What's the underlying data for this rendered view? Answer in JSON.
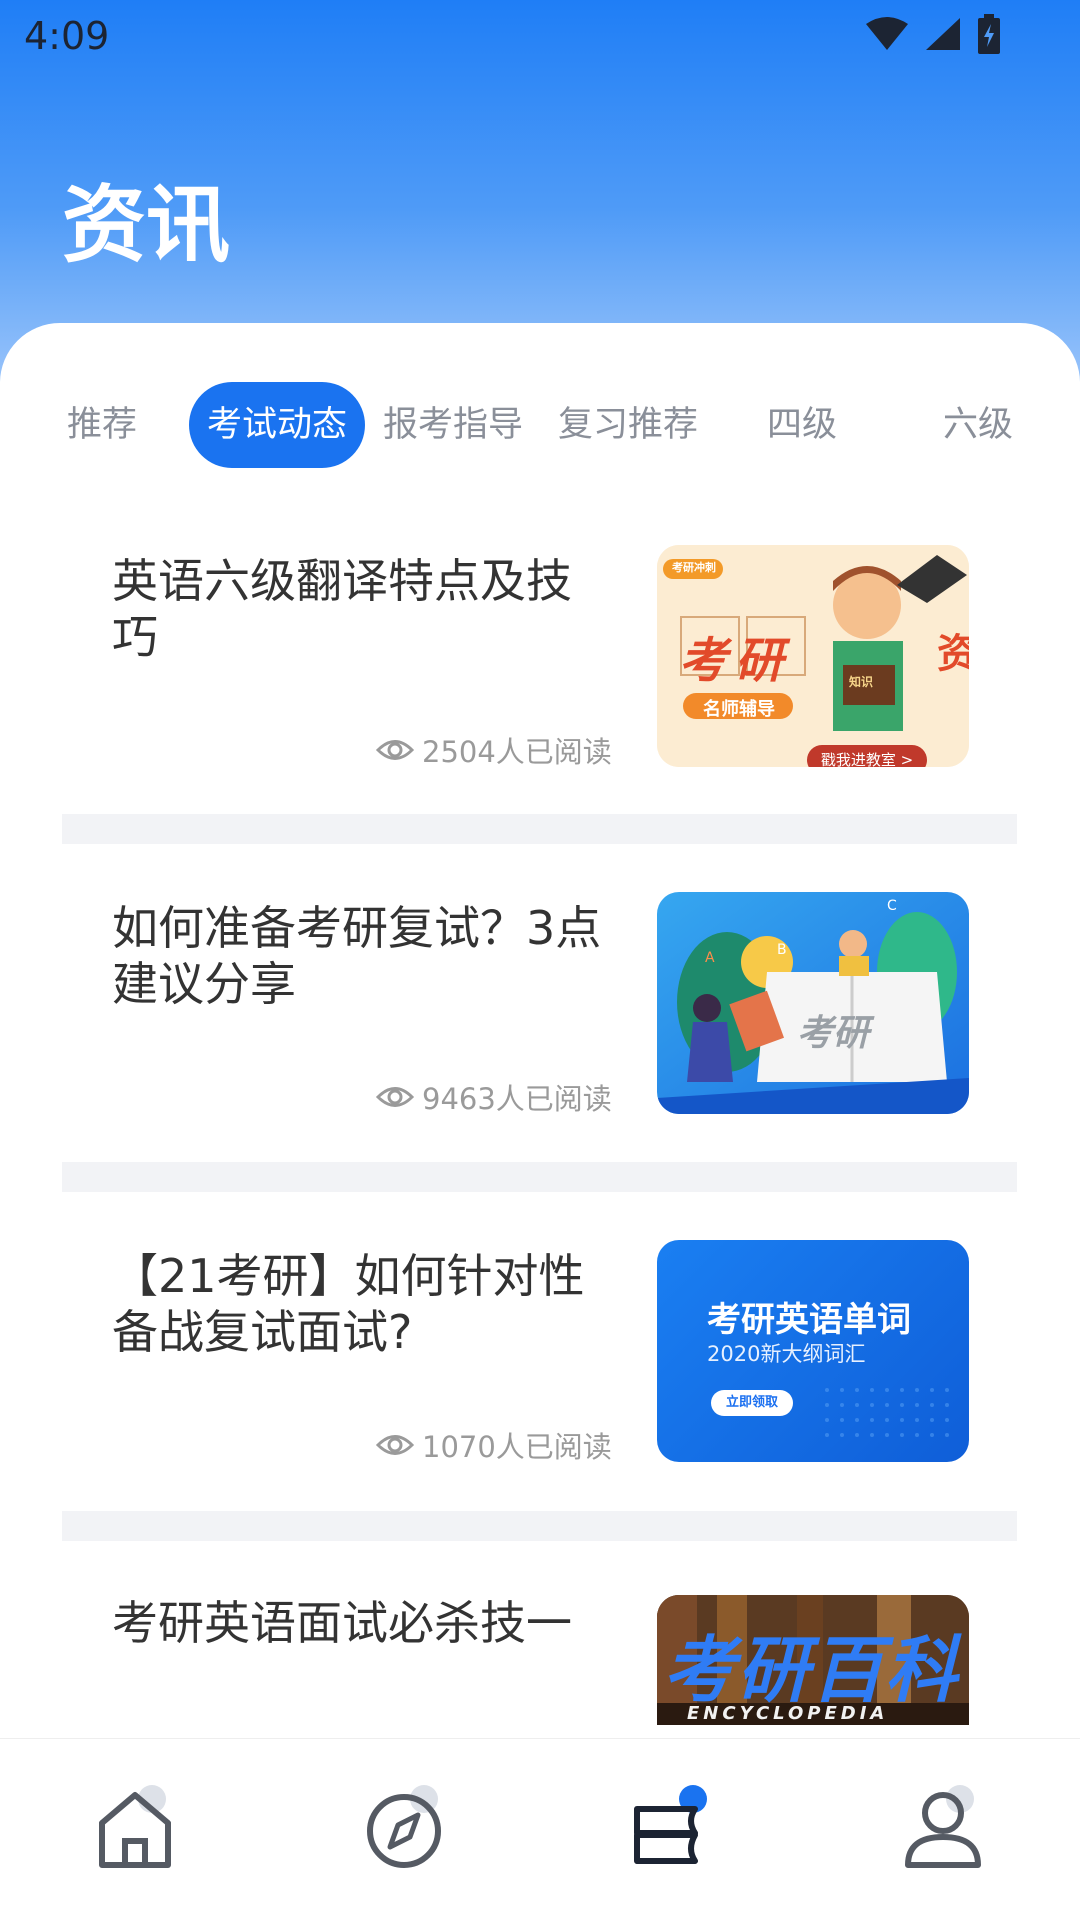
{
  "status": {
    "time": "4:09"
  },
  "page": {
    "title": "资讯"
  },
  "tabs": [
    {
      "label": "推荐",
      "active": false
    },
    {
      "label": "考试动态",
      "active": true
    },
    {
      "label": "报考指导",
      "active": false
    },
    {
      "label": "复习推荐",
      "active": false
    },
    {
      "label": "四级",
      "active": false
    },
    {
      "label": "六级",
      "active": false
    }
  ],
  "articles": [
    {
      "title": "英语六级翻译特点及技巧",
      "reads": "2504人已阅读",
      "thumb": {
        "tag": "考研冲刺",
        "main": "考研",
        "side": "资",
        "sub": "名师辅导",
        "cta": "戳我进教室 >",
        "book": "知识"
      }
    },
    {
      "title": "如何准备考研复试？3点建议分享",
      "reads": "9463人已阅读",
      "thumb": {
        "book": "考研"
      }
    },
    {
      "title": "【21考研】如何针对性备战复试面试?",
      "reads": "1070人已阅读",
      "thumb": {
        "main": "考研英语单词",
        "sub": "2020新大纲词汇",
        "cta": "立即领取"
      }
    },
    {
      "title": "考研英语面试必杀技一",
      "thumb": {
        "main": "考研百科",
        "sub": "ENCYCLOPEDIA"
      }
    }
  ],
  "nav": [
    {
      "name": "home"
    },
    {
      "name": "discover"
    },
    {
      "name": "news"
    },
    {
      "name": "profile"
    }
  ],
  "colors": {
    "accent": "#1a73f0",
    "header_top": "#1f7ef6",
    "text": "#333333",
    "muted": "#9a9a9a"
  }
}
